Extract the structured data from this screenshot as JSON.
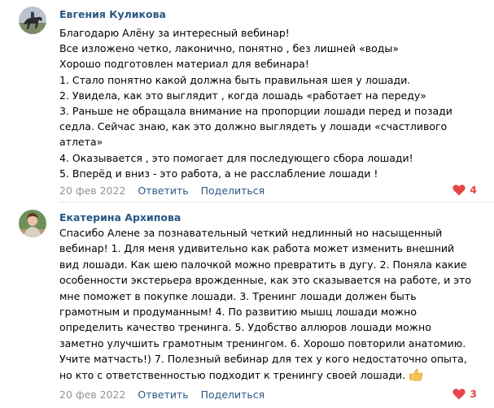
{
  "comments": [
    {
      "author": "Евгения Куликова",
      "lines": [
        "Благодарю Алёну за интересный вебинар!",
        "Все изложено четко, лаконично, понятно , без лишней «воды»",
        "Хорошо подготовлен материал для вебинара!",
        "1. Стало понятно какой должна быть правильная шея у лошади.",
        "2. Увидела, как это выглядит , когда лошадь «работает на переду»",
        "3. Раньше не обращала внимание на пропорции лошади перед и позади",
        "седла. Сейчас знаю, как это должно выглядеть у лошади «счастливого",
        "атлета»",
        "4. Оказывается , это помогает для последующего сбора лошади!",
        "5. Вперёд и вниз - это работа, а не расслабление лошади !"
      ],
      "date": "20 фев 2022",
      "reply": "Ответить",
      "share": "Поделиться",
      "likes": "4"
    },
    {
      "author": "Екатерина Архипова",
      "lines": [
        "Спасибо Алене за познавательный четкий недлинный но насыщенный",
        "вебинар! 1. Для меня удивительно как работа может изменить внешний",
        "вид лошади. Как шею палочкой можно превратить в дугу. 2. Поняла какие",
        "особенности экстерьера врожденные, как это сказывается на работе, и это",
        "мне поможет в покупке лошади. 3. Тренинг лошади должен быть",
        "грамотным и продуманным! 4. По развитию мышц лошади можно",
        "определить качество тренинга. 5. Удобство аллюров лошади можно",
        "заметно улучшить грамотным тренингом. 6. Хорошо повторили анатомию.",
        "Учите матчасть!) 7. Полезный вебинар для тех у кого недостаточно опыта,",
        "но кто с ответственностью подходит к тренингу своей лошади."
      ],
      "date": "20 фев 2022",
      "reply": "Ответить",
      "share": "Поделиться",
      "likes": "3"
    }
  ],
  "colors": {
    "author": "#2a5885",
    "link": "#2a5885",
    "meta": "#939393",
    "like": "#e64646",
    "divider": "#e7e8ec"
  },
  "icons": {
    "like": "heart-icon",
    "emoji": "thumbs-up-icon"
  }
}
